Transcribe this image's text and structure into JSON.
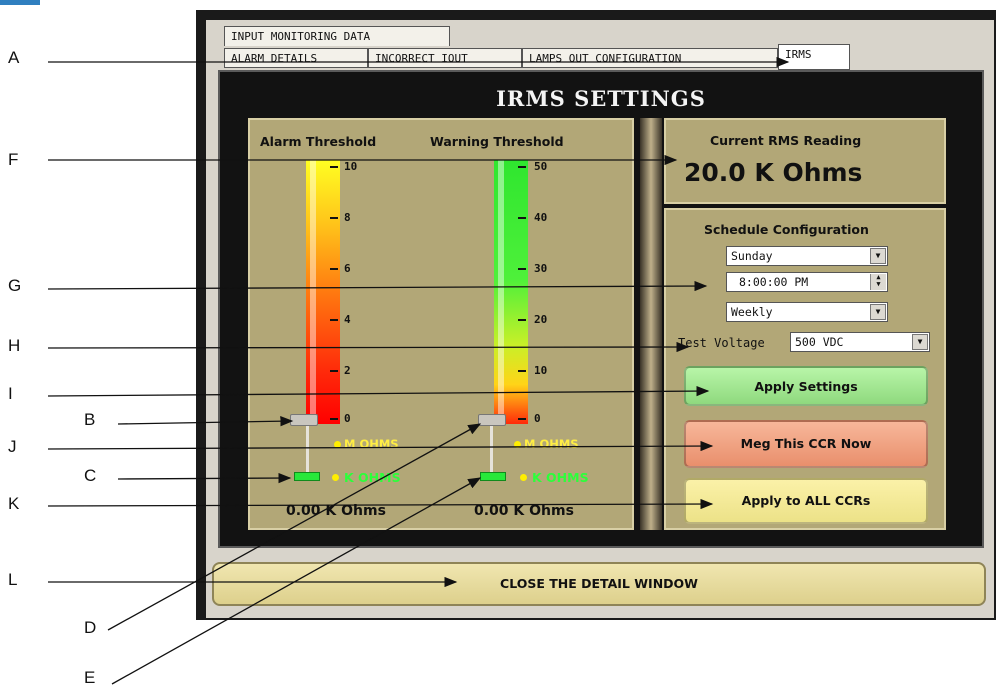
{
  "tabs": {
    "input_monitoring": "INPUT MONITORING DATA",
    "alarm_details": "ALARM DETAILS",
    "incorrect_iout": "INCORRECT IOUT",
    "lamps_out": "LAMPS OUT CONFIGURATION",
    "irms": "IRMS"
  },
  "panel": {
    "title": "IRMS SETTINGS"
  },
  "rms": {
    "label": "Current RMS Reading",
    "value": "20.0 K Ohms"
  },
  "alarm": {
    "label": "Alarm Threshold",
    "ticks": [
      "10",
      "8",
      "6",
      "4",
      "2",
      "0"
    ],
    "unit_m": "M OHMS",
    "unit_k": "K OHMS",
    "reading": "0.00 K Ohms"
  },
  "warning": {
    "label": "Warning Threshold",
    "ticks": [
      "50",
      "40",
      "30",
      "20",
      "10",
      "0"
    ],
    "unit_m": "M OHMS",
    "unit_k": "K OHMS",
    "reading": "0.00 K Ohms"
  },
  "schedule": {
    "label": "Schedule Configuration",
    "day": "Sunday",
    "time": "8:00:00 PM",
    "frequency": "Weekly",
    "test_voltage_label": "Test Voltage",
    "test_voltage": "500 VDC"
  },
  "buttons": {
    "apply_settings": "Apply Settings",
    "meg_now": "Meg This CCR Now",
    "apply_all": "Apply to ALL CCRs",
    "close": "CLOSE THE DETAIL WINDOW"
  },
  "callouts": [
    "A",
    "B",
    "C",
    "D",
    "E",
    "F",
    "G",
    "H",
    "I",
    "J",
    "K",
    "L"
  ],
  "colors": {
    "accent_blue": "#2f7fbf",
    "khaki": "#b2a777",
    "panel_dark": "#121212"
  }
}
